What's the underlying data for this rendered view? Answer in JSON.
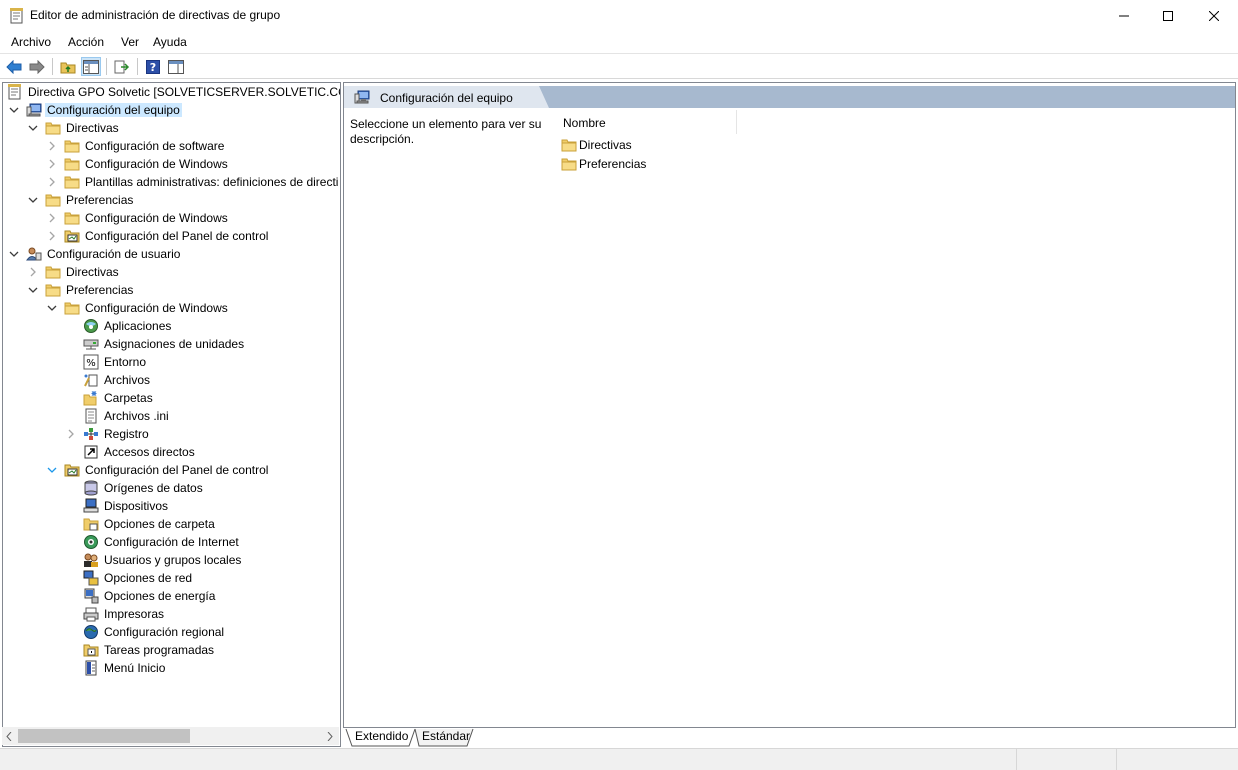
{
  "window": {
    "title": "Editor de administración de directivas de grupo"
  },
  "menu": [
    "Archivo",
    "Acción",
    "Ver",
    "Ayuda"
  ],
  "toolbar": {
    "icons": [
      "back-arrow-icon",
      "forward-arrow-icon",
      "up-folder-icon",
      "show-hide-tree-icon",
      "export-list-icon",
      "help-icon",
      "properties-view-icon"
    ]
  },
  "tree": [
    {
      "label": "Directiva GPO Solvetic [SOLVETICSERVER.SOLVETIC.COM]",
      "icon": "gpo-document-icon",
      "expander": "none"
    },
    {
      "label": "Configuración del equipo",
      "icon": "computer-icon",
      "expander": "expanded",
      "selected": true
    },
    {
      "label": "Directivas",
      "icon": "folder-icon",
      "expander": "expanded"
    },
    {
      "label": "Configuración de software",
      "icon": "folder-icon",
      "expander": "collapsed"
    },
    {
      "label": "Configuración de Windows",
      "icon": "folder-icon",
      "expander": "collapsed"
    },
    {
      "label": "Plantillas administrativas: definiciones de directi",
      "icon": "folder-icon",
      "expander": "collapsed"
    },
    {
      "label": "Preferencias",
      "icon": "folder-icon",
      "expander": "expanded"
    },
    {
      "label": "Configuración de Windows",
      "icon": "folder-icon",
      "expander": "collapsed"
    },
    {
      "label": "Configuración del Panel de control",
      "icon": "control-panel-folder-icon",
      "expander": "collapsed"
    },
    {
      "label": "Configuración de usuario",
      "icon": "user-icon",
      "expander": "expanded"
    },
    {
      "label": "Directivas",
      "icon": "folder-icon",
      "expander": "collapsed"
    },
    {
      "label": "Preferencias",
      "icon": "folder-icon",
      "expander": "expanded"
    },
    {
      "label": "Configuración de Windows",
      "icon": "folder-icon",
      "expander": "expanded"
    },
    {
      "label": "Aplicaciones",
      "icon": "applications-icon",
      "expander": "none"
    },
    {
      "label": "Asignaciones de unidades",
      "icon": "drive-map-icon",
      "expander": "none"
    },
    {
      "label": "Entorno",
      "icon": "environment-icon",
      "expander": "none"
    },
    {
      "label": "Archivos",
      "icon": "files-icon",
      "expander": "none"
    },
    {
      "label": "Carpetas",
      "icon": "folders-icon",
      "expander": "none"
    },
    {
      "label": "Archivos .ini",
      "icon": "ini-file-icon",
      "expander": "none"
    },
    {
      "label": "Registro",
      "icon": "registry-icon",
      "expander": "collapsed"
    },
    {
      "label": "Accesos directos",
      "icon": "shortcut-icon",
      "expander": "none"
    },
    {
      "label": "Configuración del Panel de control",
      "icon": "control-panel-folder-icon",
      "expander": "expanded-blue"
    },
    {
      "label": "Orígenes de datos",
      "icon": "data-sources-icon",
      "expander": "none"
    },
    {
      "label": "Dispositivos",
      "icon": "devices-icon",
      "expander": "none"
    },
    {
      "label": "Opciones de carpeta",
      "icon": "folder-options-icon",
      "expander": "none"
    },
    {
      "label": "Configuración de Internet",
      "icon": "internet-settings-icon",
      "expander": "none"
    },
    {
      "label": "Usuarios y grupos locales",
      "icon": "local-users-icon",
      "expander": "none"
    },
    {
      "label": "Opciones de red",
      "icon": "network-options-icon",
      "expander": "none"
    },
    {
      "label": "Opciones de energía",
      "icon": "power-options-icon",
      "expander": "none"
    },
    {
      "label": "Impresoras",
      "icon": "printers-icon",
      "expander": "none"
    },
    {
      "label": "Configuración regional",
      "icon": "regional-settings-icon",
      "expander": "none"
    },
    {
      "label": "Tareas programadas",
      "icon": "scheduled-tasks-icon",
      "expander": "none"
    },
    {
      "label": "Menú Inicio",
      "icon": "start-menu-icon",
      "expander": "none"
    }
  ],
  "details": {
    "title": "Configuración del equipo",
    "description": "Seleccione un elemento para ver su descripción.",
    "column_header": "Nombre",
    "items": [
      "Directivas",
      "Preferencias"
    ]
  },
  "tabs": {
    "extended": "Extendido",
    "standard": "Estándar"
  },
  "colors": {
    "selection": "#cce8ff",
    "banner": "#a7b9cf",
    "accent": "#0078d7"
  }
}
